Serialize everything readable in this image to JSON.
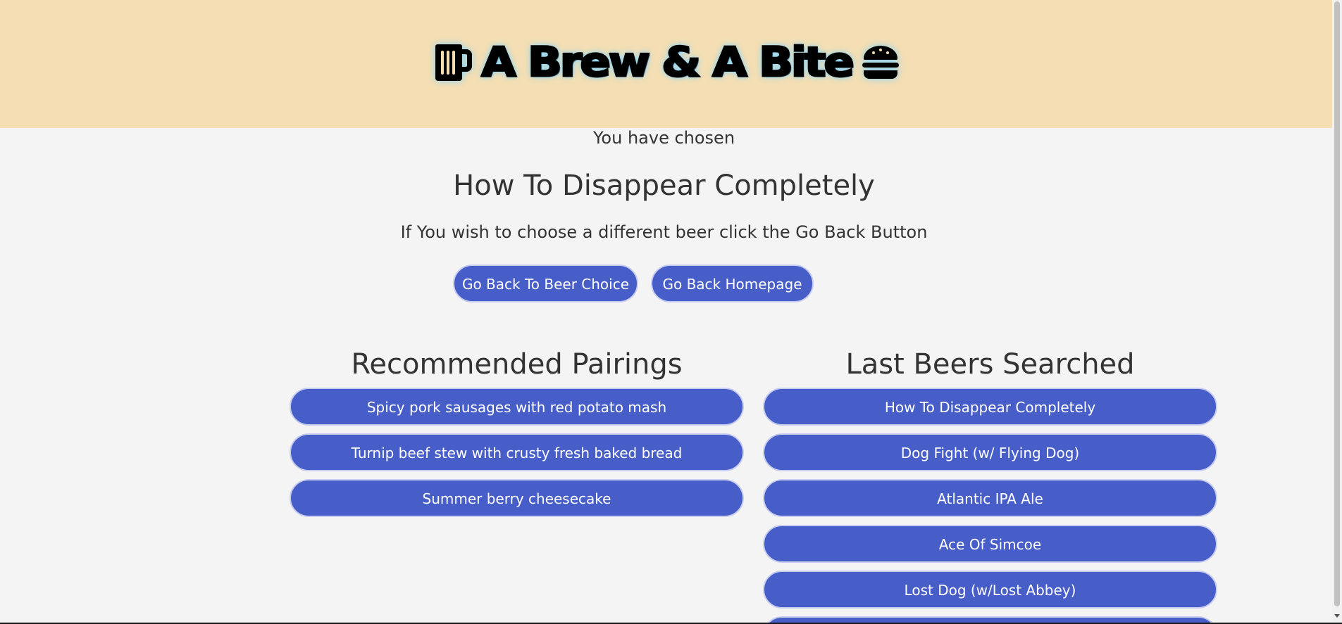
{
  "header": {
    "title": "A Brew & A Bite",
    "left_icon": "beer-mug-icon",
    "right_icon": "burger-icon",
    "background": "#f5deb3"
  },
  "selection": {
    "chosen_label": "You have chosen",
    "beer_name": "How To Disappear Completely",
    "instruction": "If You wish to choose a different beer click the Go Back Button"
  },
  "buttons": {
    "go_back_beer": "Go Back To Beer Choice",
    "go_back_home": "Go Back Homepage",
    "color": "#475dc8"
  },
  "pairings": {
    "heading": "Recommended Pairings",
    "items": [
      "Spicy pork sausages with red potato mash",
      "Turnip beef stew with crusty fresh baked bread",
      "Summer berry cheesecake"
    ]
  },
  "last_beers": {
    "heading": "Last Beers Searched",
    "items": [
      "How To Disappear Completely",
      "Dog Fight (w/ Flying Dog)",
      "Atlantic IPA Ale",
      "Ace Of Simcoe",
      "Lost Dog (w/Lost Abbey)"
    ]
  }
}
